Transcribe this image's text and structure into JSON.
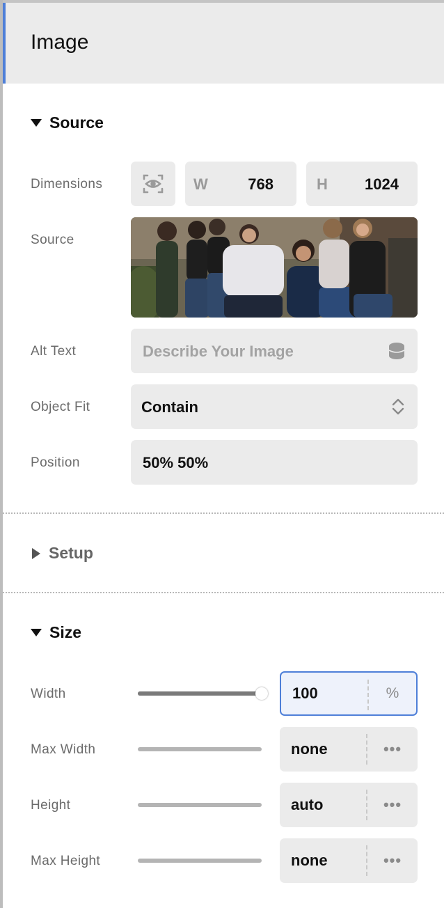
{
  "header": {
    "title": "Image"
  },
  "sections": {
    "source": {
      "title": "Source"
    },
    "setup": {
      "title": "Setup"
    },
    "size": {
      "title": "Size"
    }
  },
  "source": {
    "dimensions": {
      "label": "Dimensions",
      "w_label": "W",
      "w_value": "768",
      "h_label": "H",
      "h_value": "1024"
    },
    "image": {
      "label": "Source"
    },
    "alt_text": {
      "label": "Alt Text",
      "placeholder": "Describe Your Image"
    },
    "object_fit": {
      "label": "Object Fit",
      "value": "Contain"
    },
    "position": {
      "label": "Position",
      "value": "50% 50%"
    }
  },
  "size": {
    "width": {
      "label": "Width",
      "value": "100",
      "unit": "%",
      "slider_level": 1.0
    },
    "max_width": {
      "label": "Max Width",
      "value": "none",
      "unit": "•••"
    },
    "height": {
      "label": "Height",
      "value": "auto",
      "unit": "•••"
    },
    "max_height": {
      "label": "Max Height",
      "value": "none",
      "unit": "•••"
    }
  },
  "colors": {
    "accent": "#4e7fd8",
    "field_bg": "#ebebeb",
    "header_bg": "#ebebeb"
  }
}
